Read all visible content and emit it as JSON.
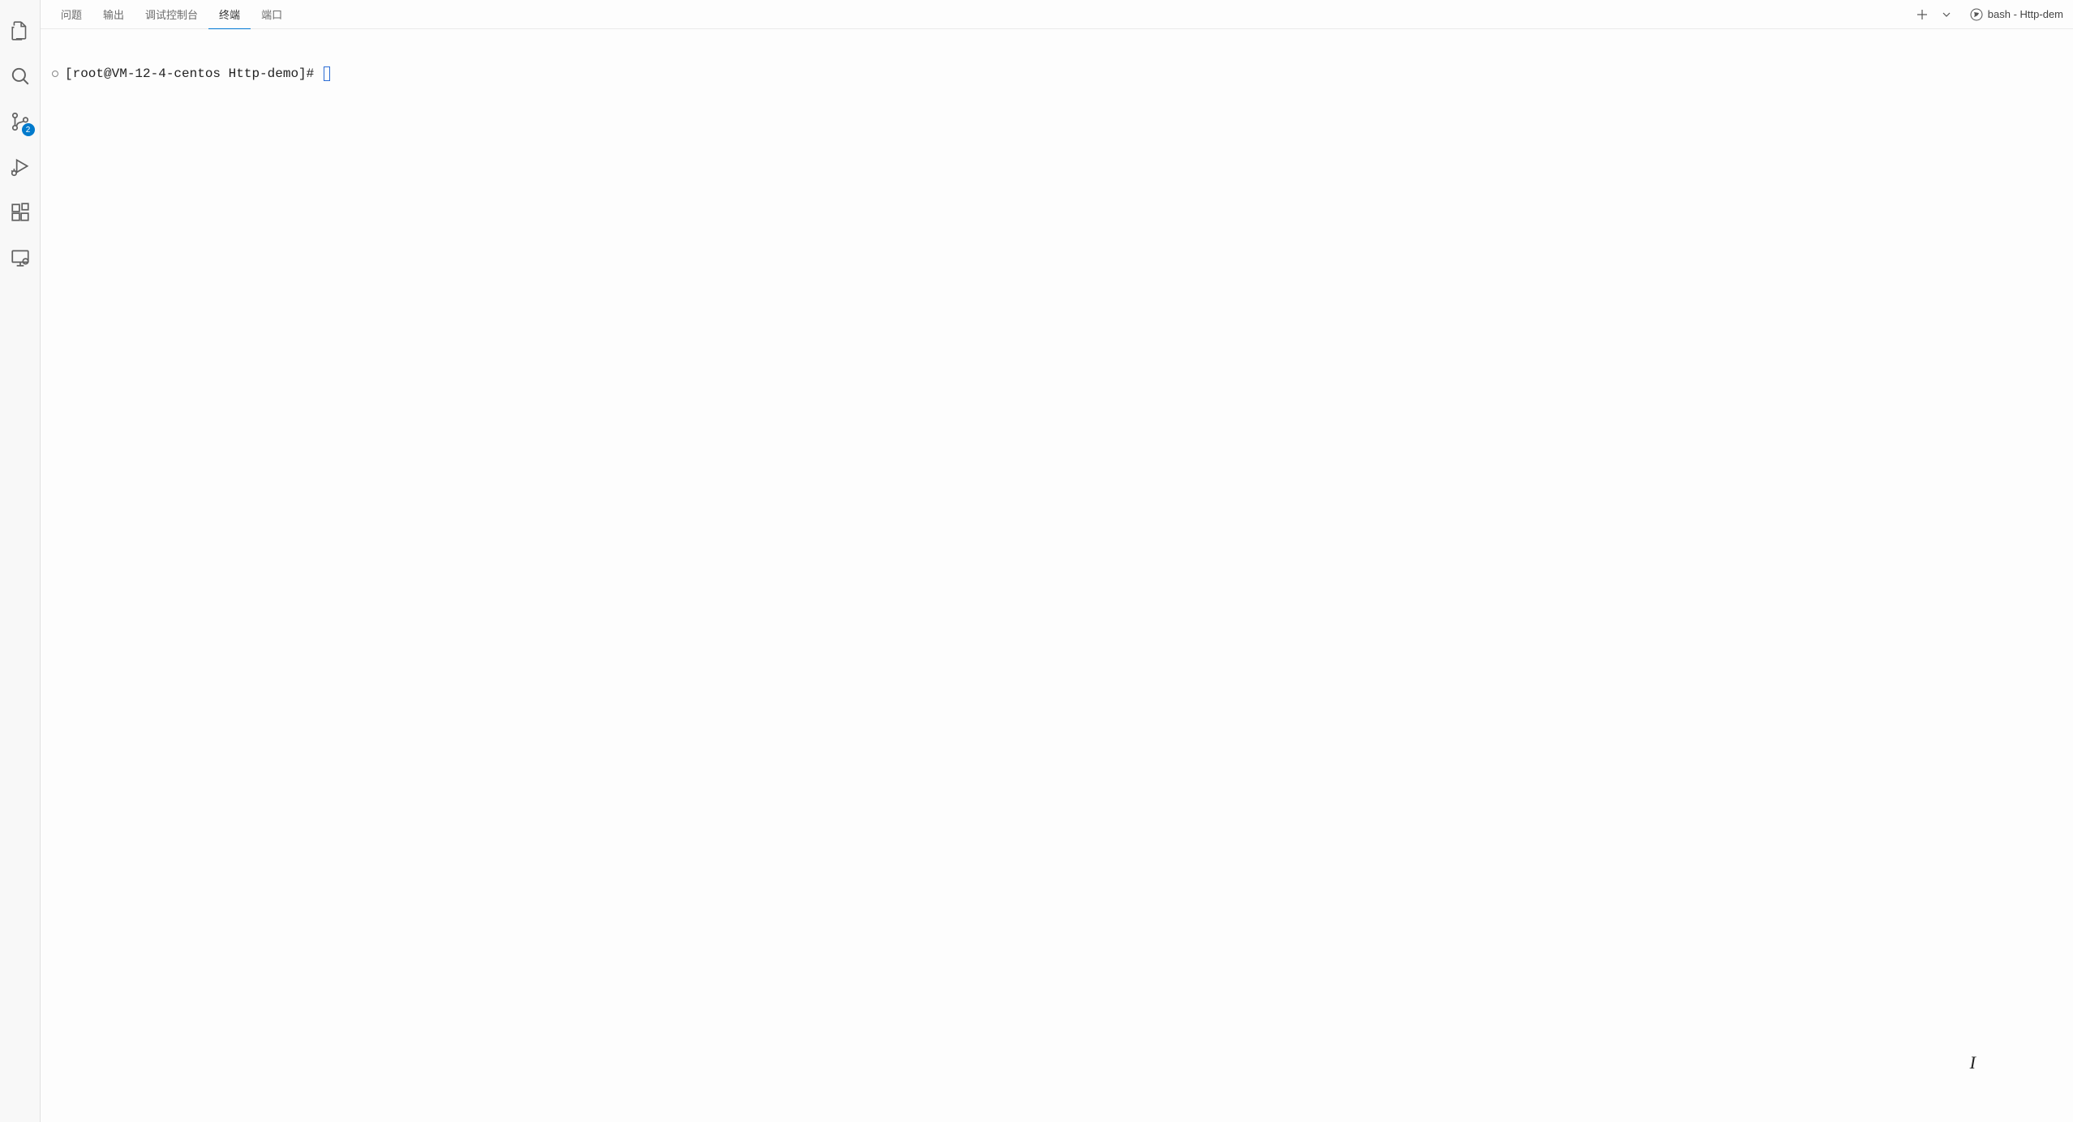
{
  "activity_bar": {
    "source_control_badge": "2"
  },
  "panel": {
    "tabs": [
      {
        "id": "problems",
        "label": "问题",
        "active": false
      },
      {
        "id": "output",
        "label": "输出",
        "active": false
      },
      {
        "id": "debug-console",
        "label": "调试控制台",
        "active": false
      },
      {
        "id": "terminal",
        "label": "终端",
        "active": true
      },
      {
        "id": "ports",
        "label": "端口",
        "active": false
      }
    ],
    "shell_label": "bash - Http-dem"
  },
  "terminal": {
    "prompt": "[root@VM-12-4-centos Http-demo]#"
  }
}
